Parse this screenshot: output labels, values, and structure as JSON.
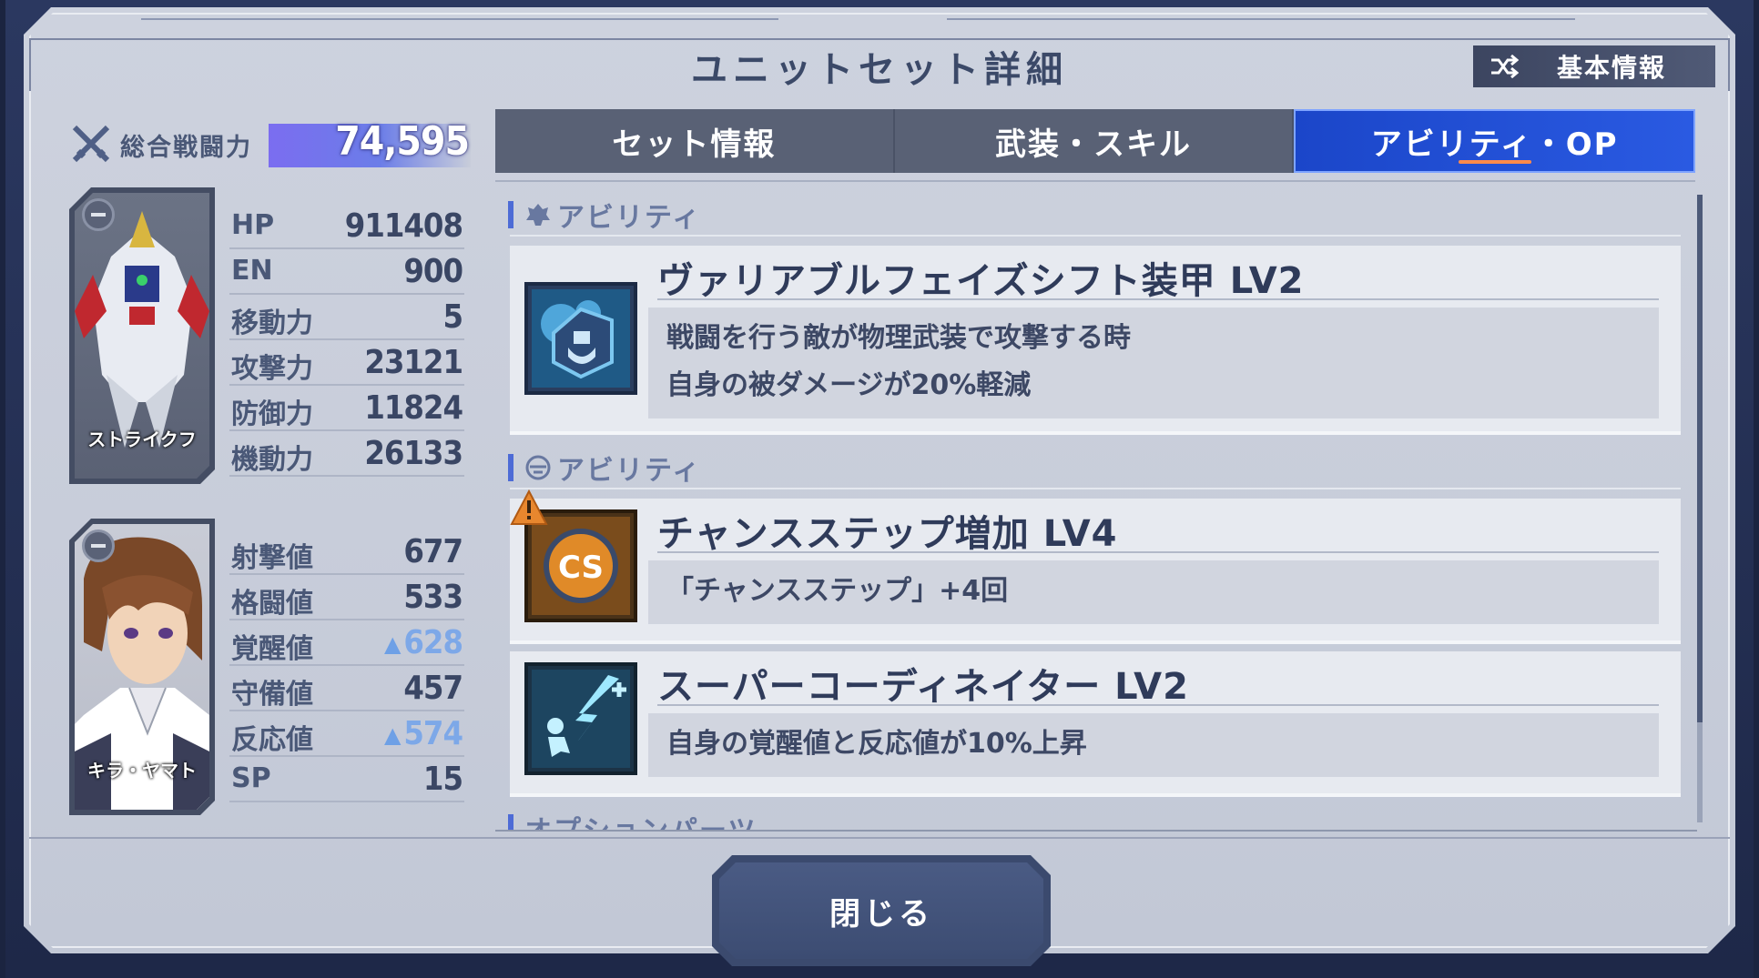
{
  "window": {
    "title": "ユニットセット詳細",
    "basic_info_button": "基本情報",
    "close_button": "閉じる"
  },
  "power": {
    "label": "総合戦闘力",
    "value": "74,595"
  },
  "unit": {
    "name": "ストライクフ",
    "stats": [
      {
        "label": "HP",
        "value": "911408",
        "boosted": false
      },
      {
        "label": "EN",
        "value": "900",
        "boosted": false
      },
      {
        "label": "移動力",
        "value": "5",
        "boosted": false
      },
      {
        "label": "攻撃力",
        "value": "23121",
        "boosted": false
      },
      {
        "label": "防御力",
        "value": "11824",
        "boosted": false
      },
      {
        "label": "機動力",
        "value": "26133",
        "boosted": false
      }
    ]
  },
  "pilot": {
    "name": "キラ・ヤマト",
    "stats": [
      {
        "label": "射撃値",
        "value": "677",
        "boosted": false
      },
      {
        "label": "格闘値",
        "value": "533",
        "boosted": false
      },
      {
        "label": "覚醒値",
        "value": "628",
        "boosted": true
      },
      {
        "label": "守備値",
        "value": "457",
        "boosted": false
      },
      {
        "label": "反応値",
        "value": "574",
        "boosted": true
      },
      {
        "label": "SP",
        "value": "15",
        "boosted": false
      }
    ]
  },
  "tabs": [
    {
      "label": "セット情報",
      "active": false
    },
    {
      "label": "武装・スキル",
      "active": false
    },
    {
      "label": "アビリティ・OP",
      "active": true
    }
  ],
  "sections": {
    "unit_ability": "アビリティ",
    "pilot_ability": "アビリティ",
    "option_parts": "オプションパーツ"
  },
  "abilities": [
    {
      "name": "ヴァリアブルフェイズシフト装甲 LV2",
      "desc_lines": [
        "戦闘を行う敵が物理武装で攻撃する時",
        "自身の被ダメージが20%軽減"
      ],
      "icon": "armor-shield-icon"
    },
    {
      "name": "チャンスステップ増加 LV4",
      "desc_lines": [
        "「チャンスステップ」+4回"
      ],
      "icon": "cs-icon",
      "badge": "!"
    },
    {
      "name": "スーパーコーディネイター LV2",
      "desc_lines": [
        "自身の覚醒値と反応値が10%上昇"
      ],
      "icon": "lightning-figure-icon"
    }
  ],
  "colors": {
    "active_tab": "#1b46c9",
    "power_bar": "#7b6df0",
    "boost": "#7da8e8"
  }
}
